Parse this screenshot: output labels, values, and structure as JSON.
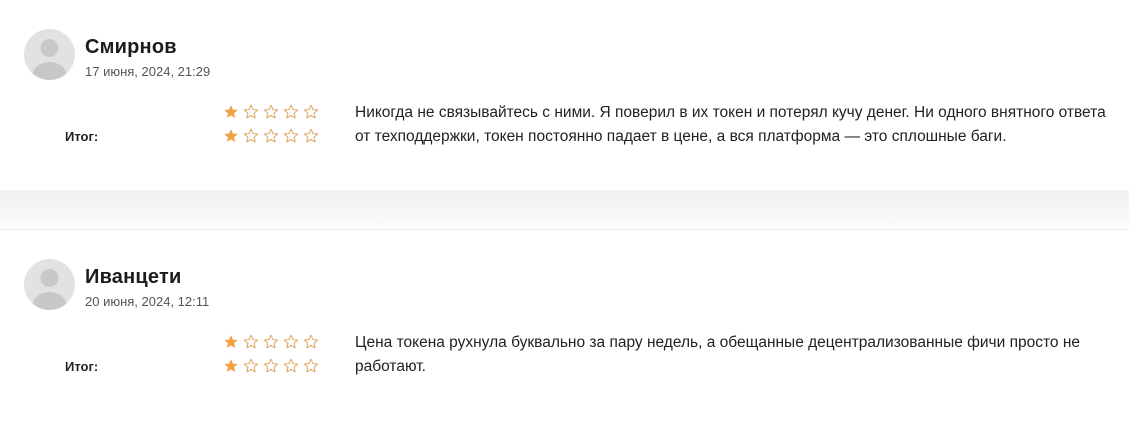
{
  "reviews": [
    {
      "author": "Смирнов",
      "date": "17 июня, 2024, 21:29",
      "total_label": "Итог:",
      "rating_rows": [
        1,
        1
      ],
      "max_rating": 5,
      "text": "Никогда не связывайтесь с ними. Я поверил в их токен и потерял кучу денег. Ни одного внятного ответа от техподдержки, токен постоянно падает в цене, а вся платформа — это сплошные баги."
    },
    {
      "author": "Иванцети",
      "date": "20 июня, 2024, 12:11",
      "total_label": "Итог:",
      "rating_rows": [
        1,
        1
      ],
      "max_rating": 5,
      "text": "Цена токена рухнула буквально за пару недель, а обещанные децентрализованные фичи просто не работают."
    }
  ],
  "colors": {
    "star_filled": "#f0a045",
    "star_empty": "#e0a661",
    "avatar_bg": "#e2e2e2",
    "avatar_figure": "#c8c8c8"
  },
  "icons": {
    "avatar": "user-silhouette-icon",
    "star_filled": "star-filled-icon",
    "star_empty": "star-outline-icon"
  }
}
